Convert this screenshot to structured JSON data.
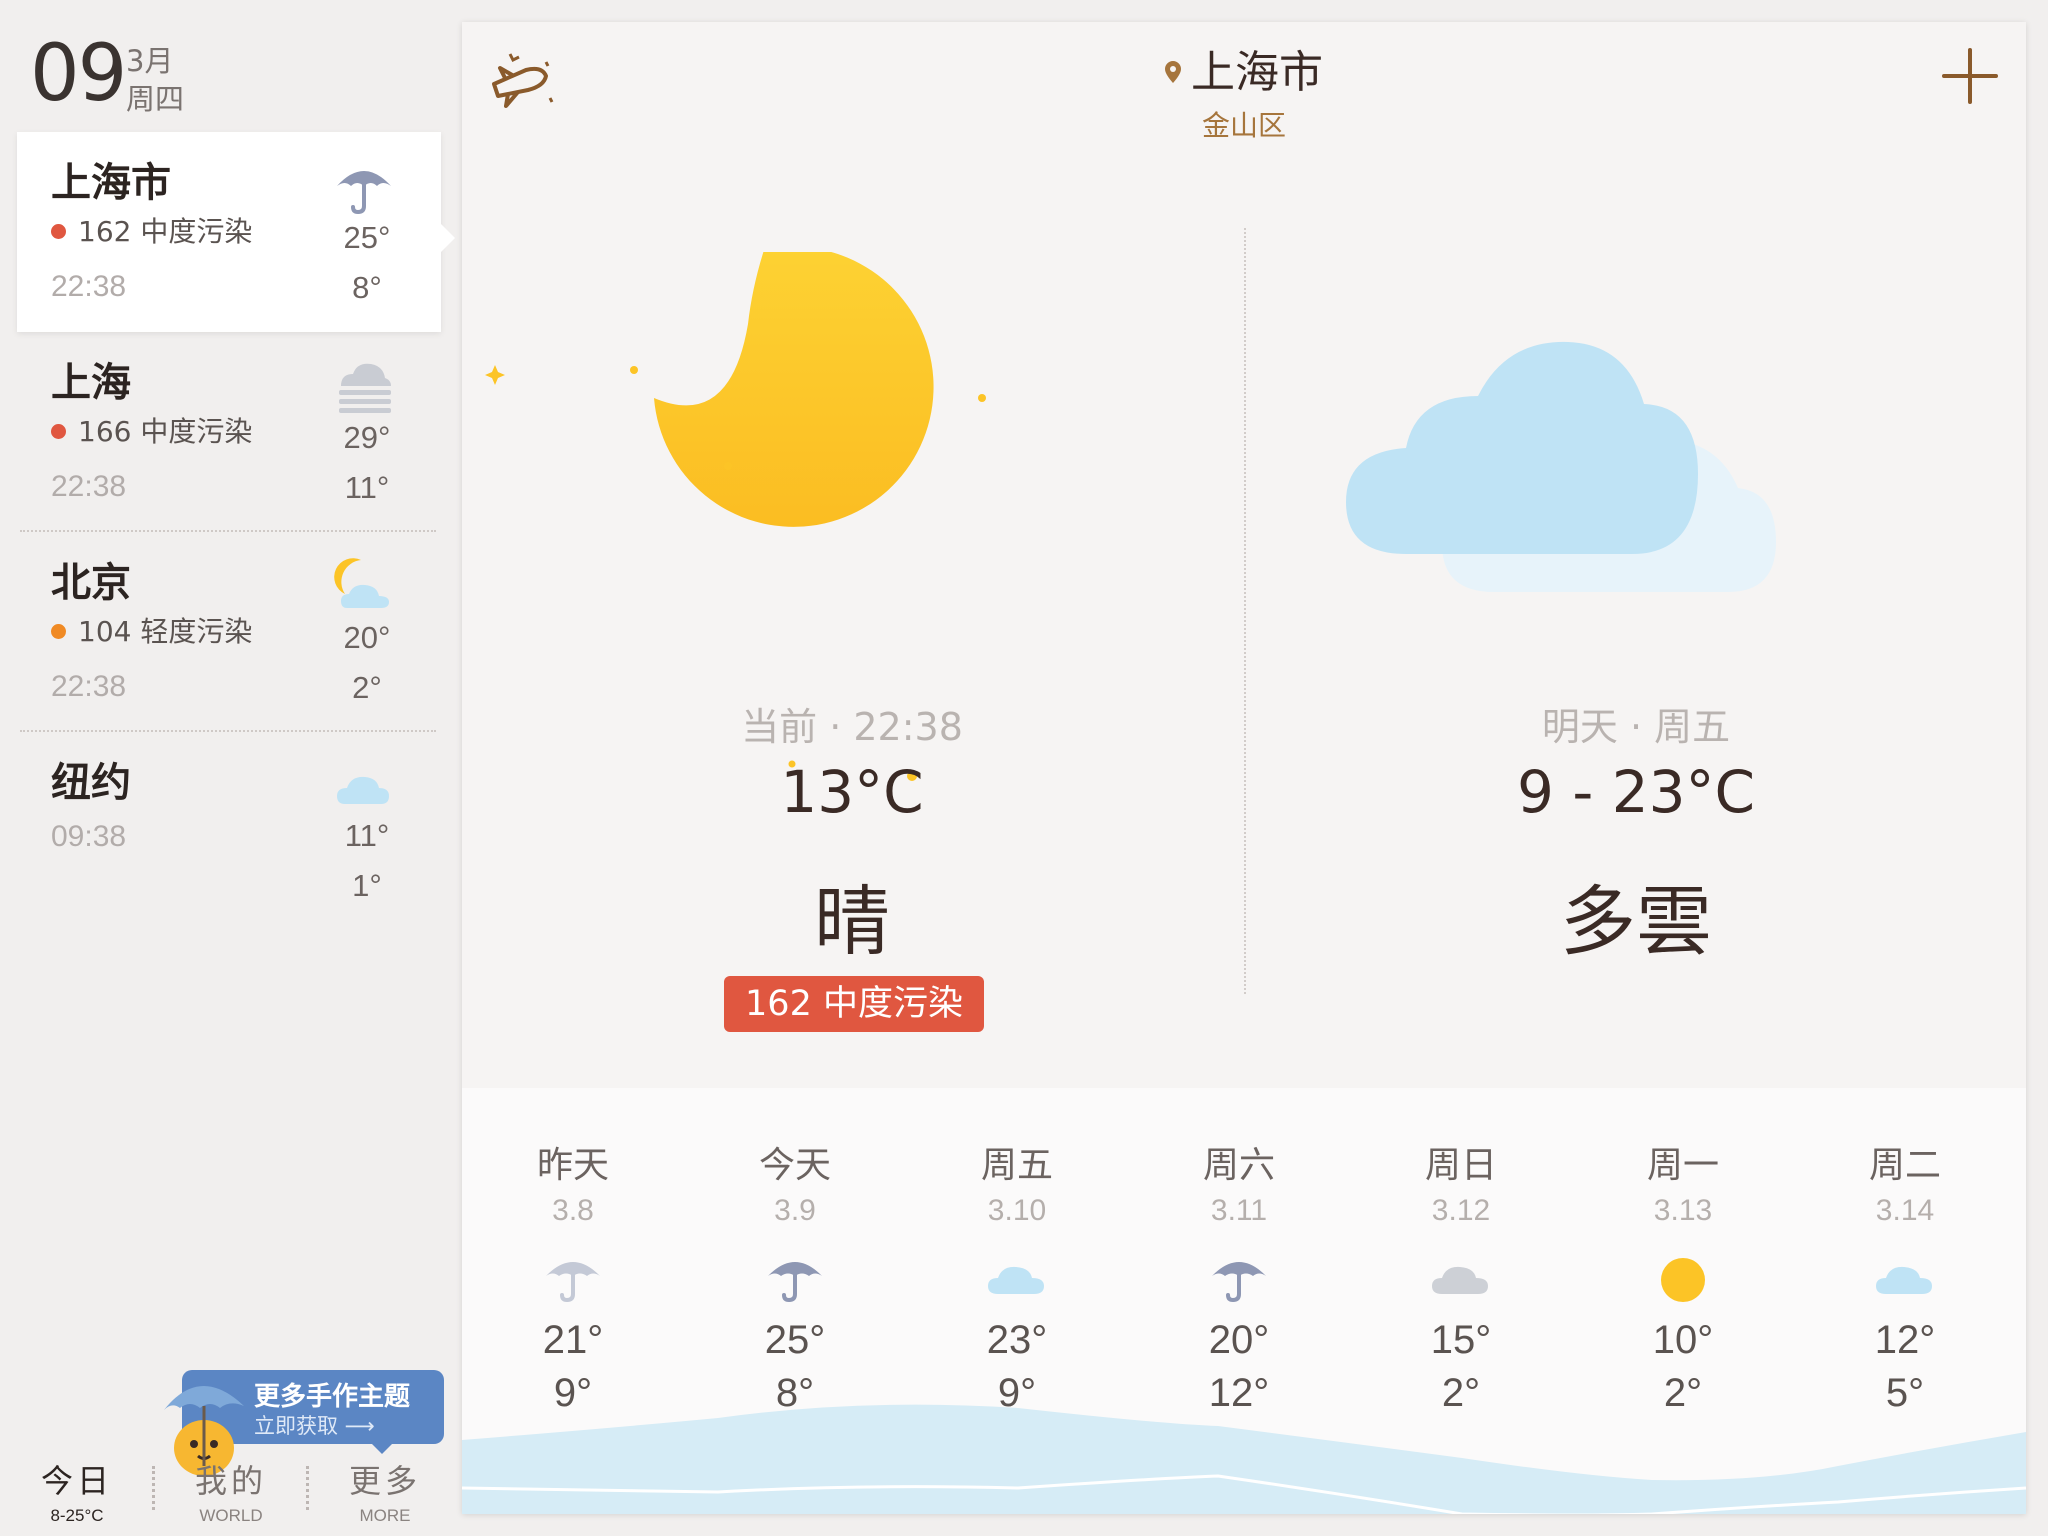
{
  "date": {
    "day": "09",
    "month": "3月",
    "weekday": "周四"
  },
  "cities": [
    {
      "name": "上海市",
      "aqi": "162 中度污染",
      "aqi_color": "#e05740",
      "time": "22:38",
      "icon": "umbrella-icon",
      "hi": "25°",
      "lo": "8°"
    },
    {
      "name": "上海",
      "aqi": "166 中度污染",
      "aqi_color": "#e05740",
      "time": "22:38",
      "icon": "fog-icon",
      "hi": "29°",
      "lo": "11°"
    },
    {
      "name": "北京",
      "aqi": "104 轻度污染",
      "aqi_color": "#f08a24",
      "time": "22:38",
      "icon": "moon-cloud-icon",
      "hi": "20°",
      "lo": "2°"
    },
    {
      "name": "纽约",
      "aqi": "",
      "aqi_color": "",
      "time": "09:38",
      "icon": "cloud-icon",
      "hi": "11°",
      "lo": "1°"
    }
  ],
  "promo": {
    "title": "更多手作主题",
    "subtitle": "立即获取 ⟶"
  },
  "tabs": [
    {
      "cn": "今日",
      "en": "8-25°C"
    },
    {
      "cn": "我的",
      "en": "WORLD"
    },
    {
      "cn": "更多",
      "en": "MORE"
    }
  ],
  "location": {
    "city": "上海市",
    "district": "金山区"
  },
  "current": {
    "label": "当前 · 22:38",
    "temp": "13°C",
    "condition": "晴",
    "aqi": "162 中度污染",
    "icon": "moon-icon"
  },
  "tomorrow": {
    "label": "明天 · 周五",
    "temp": "9 - 23°C",
    "condition": "多雲",
    "icon": "cloud-icon"
  },
  "forecast": [
    {
      "day": "昨天",
      "date": "3.8",
      "icon": "umbrella-icon",
      "hi": "21°",
      "lo": "9°"
    },
    {
      "day": "今天",
      "date": "3.9",
      "icon": "umbrella-icon",
      "hi": "25°",
      "lo": "8°"
    },
    {
      "day": "周五",
      "date": "3.10",
      "icon": "cloud-icon",
      "hi": "23°",
      "lo": "9°"
    },
    {
      "day": "周六",
      "date": "3.11",
      "icon": "umbrella-icon",
      "hi": "20°",
      "lo": "12°"
    },
    {
      "day": "周日",
      "date": "3.12",
      "icon": "overcast-icon",
      "hi": "15°",
      "lo": "2°"
    },
    {
      "day": "周一",
      "date": "3.13",
      "icon": "sun-icon",
      "hi": "10°",
      "lo": "2°"
    },
    {
      "day": "周二",
      "date": "3.14",
      "icon": "cloud-icon",
      "hi": "12°",
      "lo": "5°"
    }
  ],
  "colors": {
    "aqi_badge": "#e05740",
    "accent_brown": "#a6753c",
    "sun": "#fcc426",
    "cloud": "#bfe3f5",
    "umbrella": "#8e97b3"
  }
}
